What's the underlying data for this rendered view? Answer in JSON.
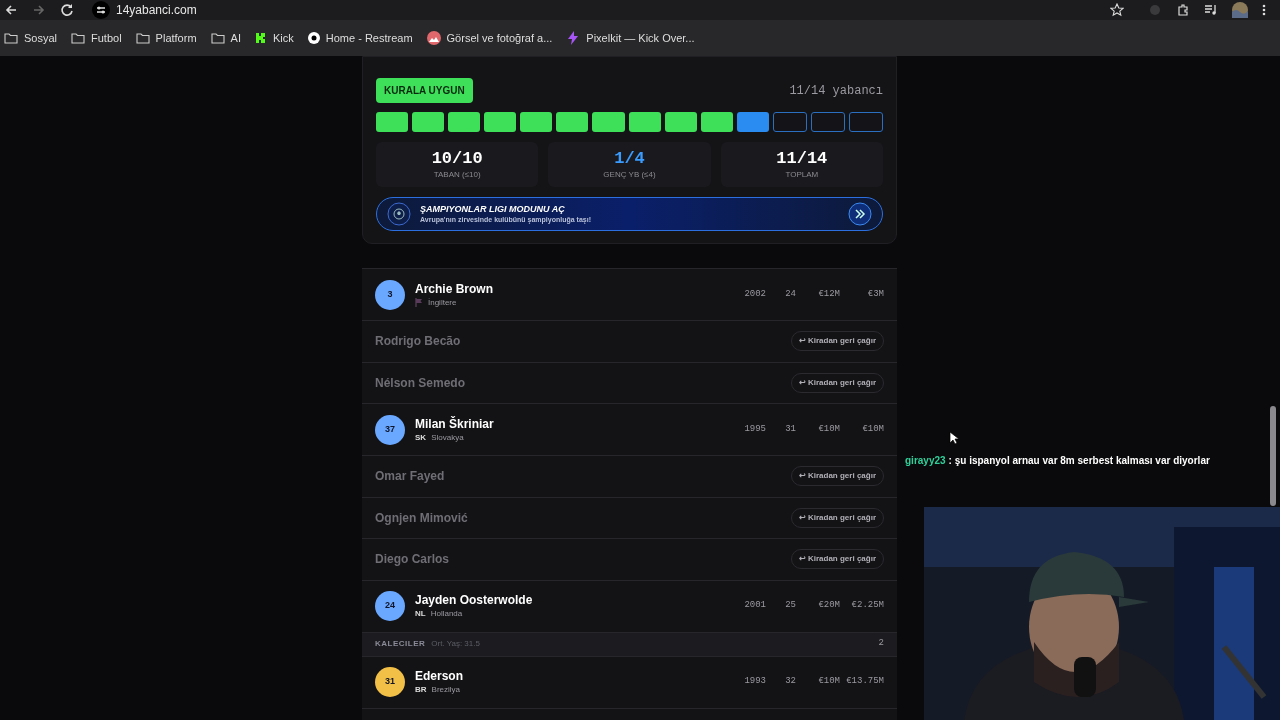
{
  "browser": {
    "url": "14yabanci.com",
    "bookmarks": [
      {
        "label": "Sosyal",
        "kind": "folder"
      },
      {
        "label": "Futbol",
        "kind": "folder"
      },
      {
        "label": "Platform",
        "kind": "folder"
      },
      {
        "label": "AI",
        "kind": "folder"
      },
      {
        "label": "Kick",
        "kind": "kick"
      },
      {
        "label": "Home - Restream",
        "kind": "restream"
      },
      {
        "label": "Görsel ve fotoğraf a..."
      },
      {
        "label": "Pixelkit — Kick Over...",
        "kind": "pixel"
      }
    ]
  },
  "quota": {
    "badge": "KURALA UYGUN",
    "count": "11/14 yabancı",
    "slots": [
      {
        "kind": "base"
      },
      {
        "kind": "base"
      },
      {
        "kind": "base"
      },
      {
        "kind": "base"
      },
      {
        "kind": "base"
      },
      {
        "kind": "base"
      },
      {
        "kind": "base"
      },
      {
        "kind": "base"
      },
      {
        "kind": "base"
      },
      {
        "kind": "base"
      },
      {
        "kind": "young"
      },
      {
        "kind": "empty"
      },
      {
        "kind": "empty"
      },
      {
        "kind": "empty"
      }
    ],
    "stats": [
      {
        "value": "10/10",
        "label": "TABAN (≤10)",
        "color": "#ffffff"
      },
      {
        "value": "1/4",
        "label": "GENÇ YB (≤4)",
        "color": "#3b9cff"
      },
      {
        "value": "11/14",
        "label": "TOPLAM",
        "color": "#ffffff"
      }
    ],
    "promo": {
      "title": "ŞAMPIYONLAR LIGI **MODUNU AÇ**",
      "subtitle": "Avrupa'nın zirvesinde kulübünü şampiyonluğa taşı!"
    }
  },
  "rows": [
    {
      "kind": "player",
      "number": "3",
      "color": "#6aa8ff",
      "name": "Archie Brown",
      "country": "İngiltere",
      "year": "2002",
      "age": "24",
      "value": "€12M",
      "wage": "€3M"
    },
    {
      "kind": "loan",
      "name": "Rodrigo Becão",
      "action": "↩ Kiradan geri çağır"
    },
    {
      "kind": "loan",
      "name": "Nélson Semedo",
      "action": "↩ Kiradan geri çağır"
    },
    {
      "kind": "player",
      "number": "37",
      "color": "#6aa8ff",
      "name": "Milan Škriniar",
      "code": "SK",
      "country": "Slovakya",
      "year": "1995",
      "age": "31",
      "value": "€10M",
      "wage": "€10M"
    },
    {
      "kind": "loan",
      "name": "Omar Fayed",
      "action": "↩ Kiradan geri çağır"
    },
    {
      "kind": "loan",
      "name": "Ognjen Mimović",
      "action": "↩ Kiradan geri çağır"
    },
    {
      "kind": "loan",
      "name": "Diego Carlos",
      "action": "↩ Kiradan geri çağır"
    },
    {
      "kind": "player",
      "number": "24",
      "color": "#6aa8ff",
      "name": "Jayden Oosterwolde",
      "code": "NL",
      "country": "Hollanda",
      "year": "2001",
      "age": "25",
      "value": "€20M",
      "wage": "€2.25M"
    },
    {
      "kind": "section",
      "title": "KALECILER",
      "note": "Ort. Yaş: 31.5",
      "count": "2"
    },
    {
      "kind": "player",
      "number": "31",
      "color": "#f2bf47",
      "name": "Ederson",
      "code": "BR",
      "country": "Brezilya",
      "year": "1993",
      "age": "32",
      "value": "€10M",
      "wage": "€13.75M"
    }
  ],
  "chat": {
    "user": "girayy23",
    "message": ": şu ispanyol arnau var 8m serbest kalması var diyorlar"
  }
}
